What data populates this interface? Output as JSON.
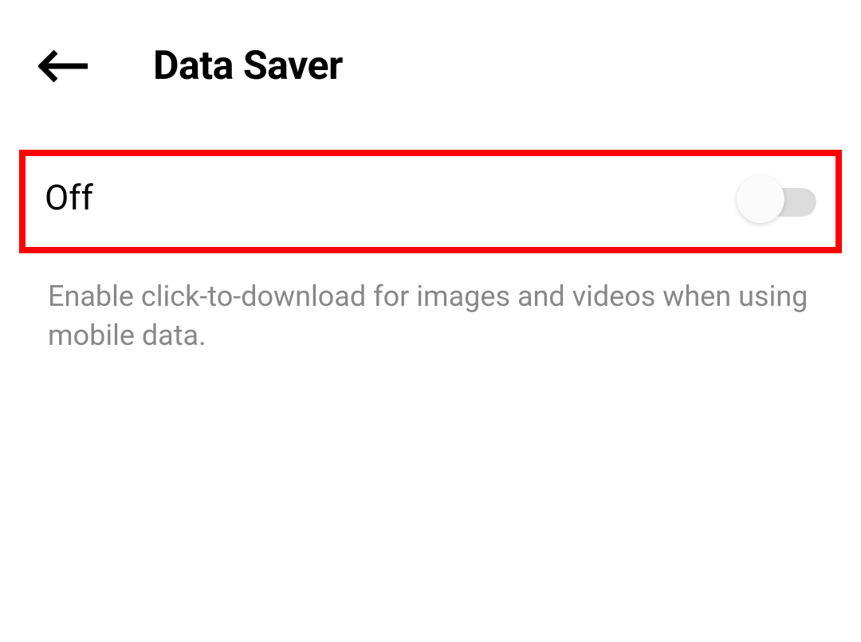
{
  "header": {
    "title": "Data Saver"
  },
  "setting": {
    "toggle_label": "Off",
    "toggle_state": "off",
    "description": "Enable click-to-download for images and videos when using mobile data."
  }
}
